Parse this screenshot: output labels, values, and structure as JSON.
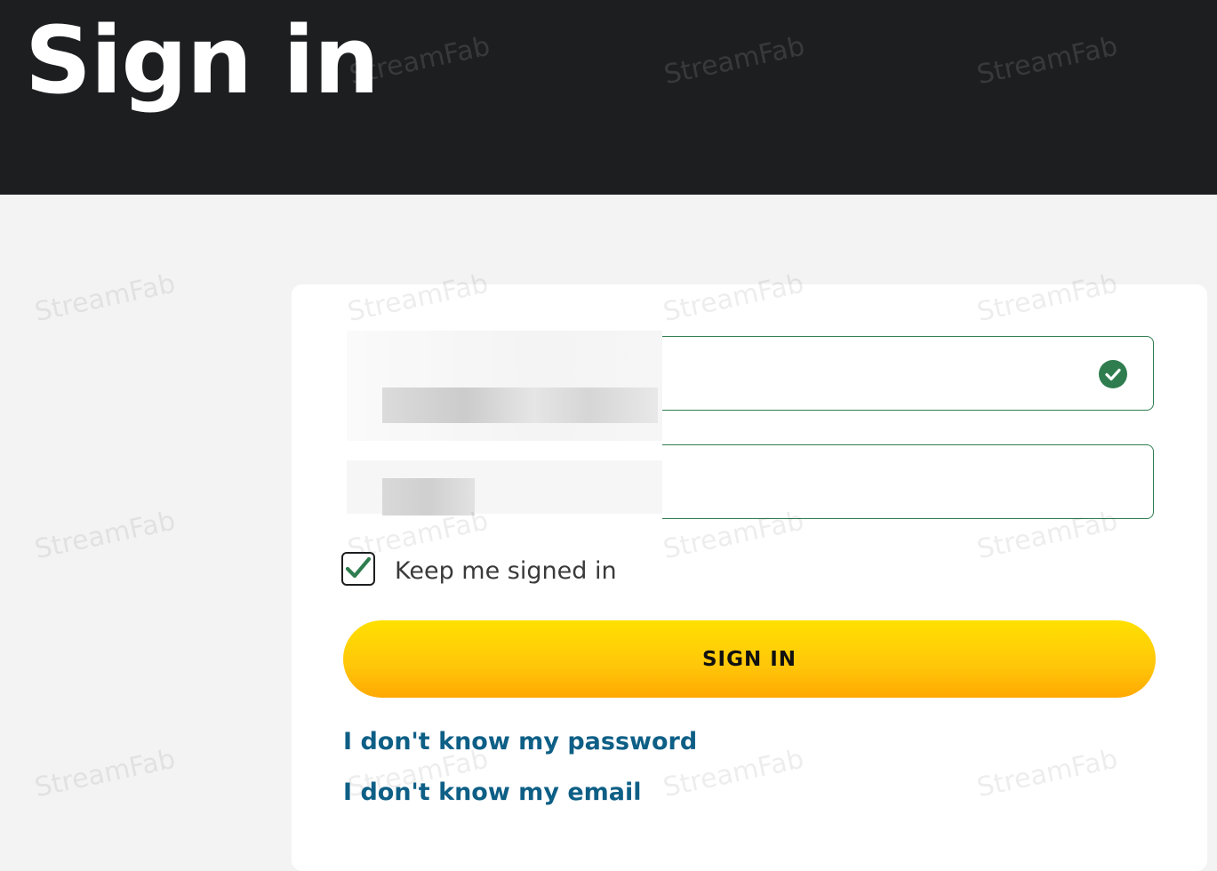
{
  "page": {
    "title": "Sign in"
  },
  "form": {
    "email_valid": true,
    "keep_signed_in_label": "Keep me signed in",
    "keep_signed_in_checked": true,
    "submit_label": "SIGN IN",
    "forgot_password_label": "I don't know my password",
    "forgot_email_label": "I don't know my email"
  },
  "watermark": {
    "text": "StreamFab"
  },
  "colors": {
    "header_bg": "#1d1e20",
    "page_bg": "#f3f3f3",
    "valid_green": "#2f7d4f",
    "button_yellow": "#ffc60a",
    "link_blue": "#0e5f86"
  },
  "icons": {
    "email_status": "check-circle-icon",
    "keep_signed_in": "checkmark-icon"
  }
}
